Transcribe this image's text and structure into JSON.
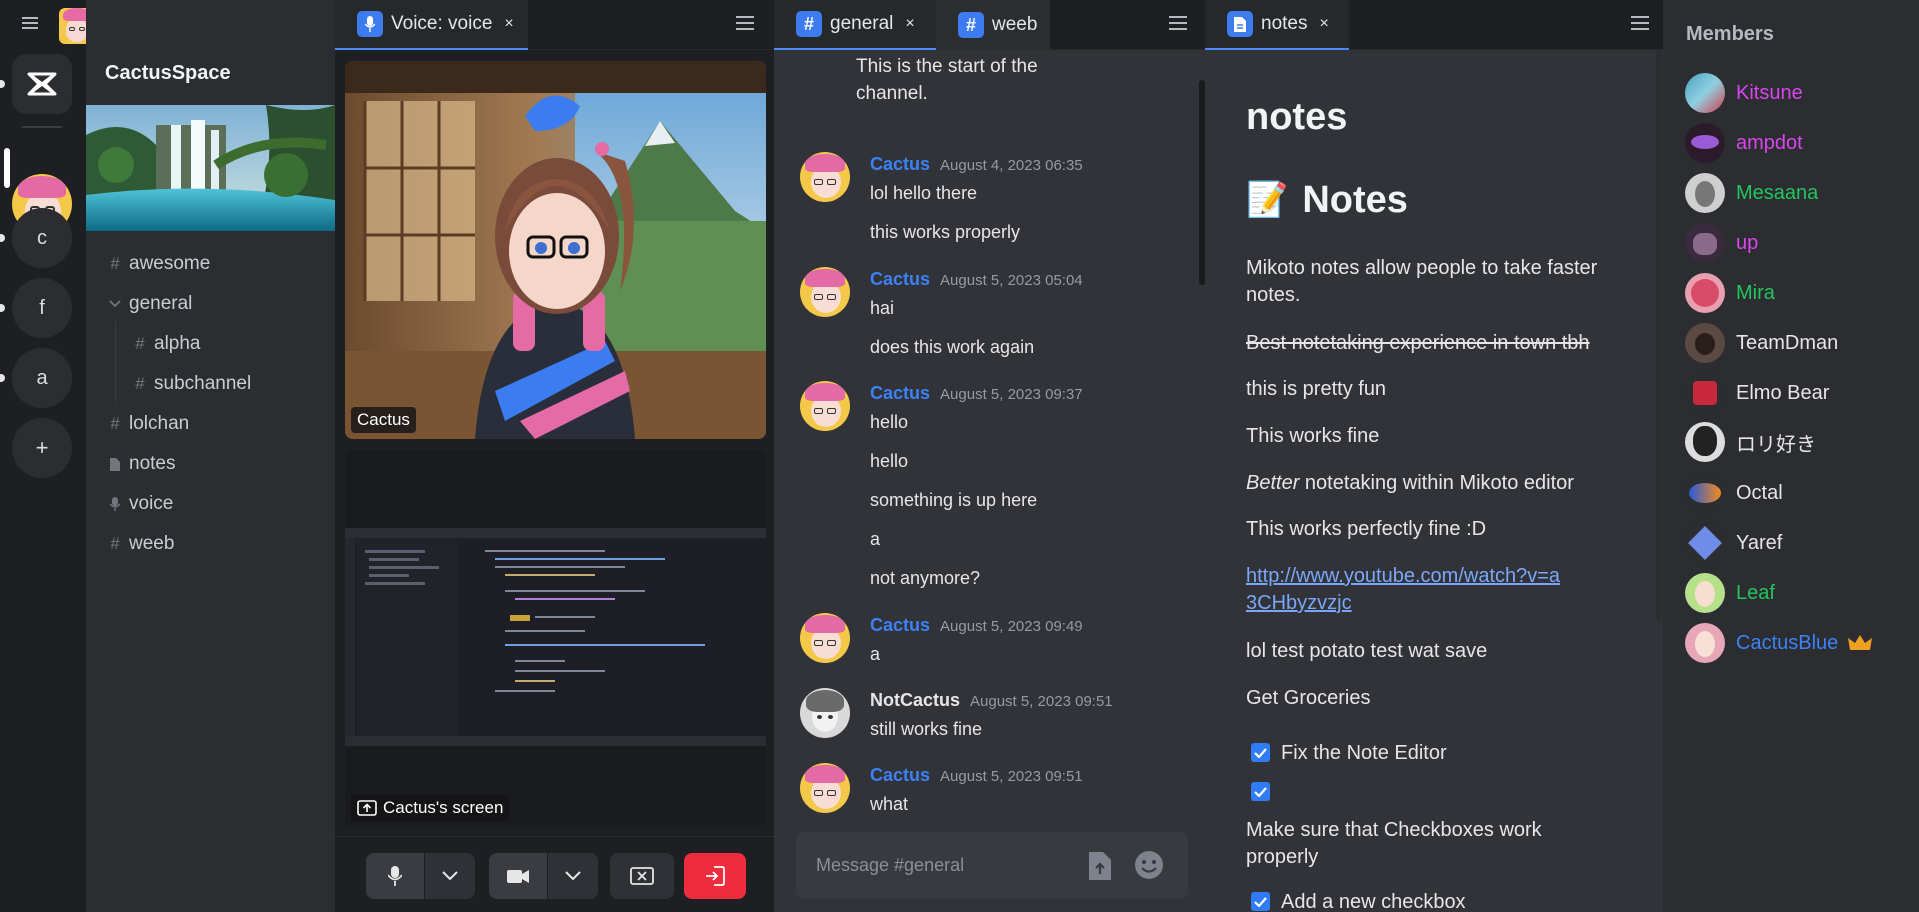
{
  "space": {
    "name": "CactusSpace"
  },
  "rail": {
    "servers": [
      "c",
      "f",
      "a"
    ],
    "add_label": "+"
  },
  "channels": [
    {
      "name": "awesome",
      "icon": "hash-icon",
      "indent": 0
    },
    {
      "name": "general",
      "icon": "chevron-down-icon",
      "indent": 0
    },
    {
      "name": "alpha",
      "icon": "hash-icon",
      "indent": 1
    },
    {
      "name": "subchannel",
      "icon": "hash-icon",
      "indent": 1
    },
    {
      "name": "lolchan",
      "icon": "hash-icon",
      "indent": 0
    },
    {
      "name": "notes",
      "icon": "document-icon",
      "indent": 0
    },
    {
      "name": "voice",
      "icon": "microphone-icon",
      "indent": 0
    },
    {
      "name": "weeb",
      "icon": "hash-icon",
      "indent": 0
    }
  ],
  "voice_pane": {
    "tab_label": "Voice: voice",
    "close_symbol": "×",
    "participant_label": "Cactus",
    "screen_label": "Cactus's screen"
  },
  "chat_pane": {
    "tabs": [
      "general",
      "weeb"
    ],
    "close_symbol": "×",
    "channel_start": "This is the start of the channel.",
    "messages": [
      {
        "author": "Cactus",
        "timestamp": "August 4, 2023 06:35",
        "lines": [
          "lol hello there",
          "this works properly"
        ]
      },
      {
        "author": "Cactus",
        "timestamp": "August 5, 2023 05:04",
        "lines": [
          "hai",
          "does this work again"
        ]
      },
      {
        "author": "Cactus",
        "timestamp": "August 5, 2023 09:37",
        "lines": [
          "hello",
          "hello",
          "something is up here",
          "a",
          "not anymore?"
        ]
      },
      {
        "author": "Cactus",
        "timestamp": "August 5, 2023 09:49",
        "lines": [
          "a"
        ]
      },
      {
        "author": "NotCactus",
        "timestamp": "August 5, 2023 09:51",
        "lines": [
          "still works fine"
        ]
      },
      {
        "author": "Cactus",
        "timestamp": "August 5, 2023 09:51",
        "lines": [
          "what"
        ]
      }
    ],
    "composer_placeholder": "Message #general"
  },
  "notes_pane": {
    "tab_label": "notes",
    "close_symbol": "×",
    "title": "notes",
    "heading": "Notes",
    "heading_emoji": "📝",
    "paragraphs": {
      "intro": "Mikoto notes allow people to take faster notes.",
      "strike": "Best notetaking experience in town tbh",
      "fun": "this is pretty fun",
      "works": "This works fine",
      "better_em": "Better",
      "better_rest": " notetaking within Mikoto editor",
      "perfect": "This works perfectly fine :D",
      "link": "http://www.youtube.com/watch?v=a3CHbyzvzjc",
      "potato": "lol test potato test wat save",
      "groceries": "Get Groceries"
    },
    "checklist": [
      {
        "label": "Fix the Note Editor",
        "checked": true
      },
      {
        "label": "",
        "checked": true
      },
      {
        "label": "Make sure that Checkboxes work properly",
        "checked": null
      },
      {
        "label": "Add a new checkbox",
        "checked": true
      }
    ]
  },
  "members": {
    "title": "Members",
    "list": [
      {
        "name": "Kitsune",
        "color": "#d946ef"
      },
      {
        "name": "ampdot",
        "color": "#d946ef"
      },
      {
        "name": "Mesaana",
        "color": "#22c55e"
      },
      {
        "name": "up",
        "color": "#d946ef"
      },
      {
        "name": "Mira",
        "color": "#22c55e"
      },
      {
        "name": "TeamDman",
        "color": "#e6e6e6"
      },
      {
        "name": "Elmo Bear",
        "color": "#e6e6e6"
      },
      {
        "name": "ロリ好き",
        "color": "#e6e6e6"
      },
      {
        "name": "Octal",
        "color": "#e6e6e6"
      },
      {
        "name": "Yaref",
        "color": "#e6e6e6"
      },
      {
        "name": "Leaf",
        "color": "#22c55e"
      },
      {
        "name": "CactusBlue",
        "color": "#3b82f6",
        "badge": "crown-icon"
      }
    ]
  }
}
